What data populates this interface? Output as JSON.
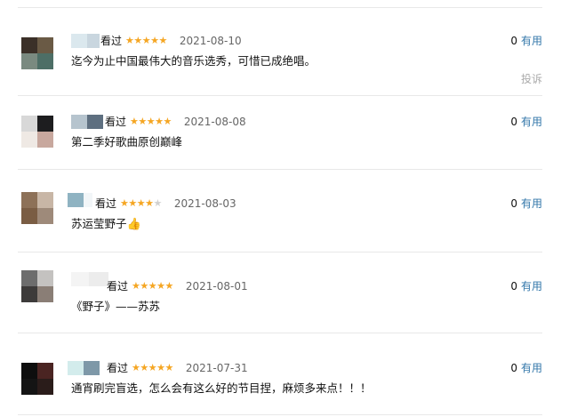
{
  "reviews": [
    {
      "seen_label": "看过",
      "rating": 5,
      "date": "2021-08-10",
      "content": "迄今为止中国最伟大的音乐选秀，可惜已成绝唱。",
      "useful_count": "0",
      "useful_label": "有用",
      "report_label": "投诉",
      "avatar_colors": [
        "#3b3028",
        "#6a5a45",
        "#7a8a80",
        "#4d6e66"
      ],
      "name_colors": [
        "#dbe8ee",
        "#c9d6df"
      ]
    },
    {
      "seen_label": "看过",
      "rating": 5,
      "date": "2021-08-08",
      "content": "第二季好歌曲原创巅峰",
      "useful_count": "0",
      "useful_label": "有用",
      "avatar_colors": [
        "#d8d8d8",
        "#1d1d1f",
        "#efe9e4",
        "#c8a89e"
      ],
      "name_colors": [
        "#b6c4ce",
        "#5e6f80"
      ]
    },
    {
      "seen_label": "看过",
      "rating": 4,
      "date": "2021-08-03",
      "content": "苏运莹野子",
      "content_icon": "👍",
      "useful_count": "0",
      "useful_label": "有用",
      "avatar_colors": [
        "#8d7158",
        "#c8b6a6",
        "#7a5d44",
        "#9e8a7a"
      ],
      "name_colors": [
        "#8fb3c2",
        "#f2f6f8"
      ]
    },
    {
      "seen_label": "看过",
      "rating": 5,
      "date": "2021-08-01",
      "content": "《野子》——苏苏",
      "useful_count": "0",
      "useful_label": "有用",
      "avatar_colors": [
        "#6d6d6d",
        "#c4c2c0",
        "#3d3b3a",
        "#8a7e76"
      ],
      "name_colors": [
        "#f4f4f4",
        "#ececec"
      ]
    },
    {
      "seen_label": "看过",
      "rating": 5,
      "date": "2021-07-31",
      "content": "通宵刷完盲选，怎么会有这么好的节目捏，麻烦多来点！！！",
      "useful_count": "0",
      "useful_label": "有用",
      "avatar_colors": [
        "#0e0e0e",
        "#4a2422",
        "#141414",
        "#2a1c1a"
      ],
      "name_colors": [
        "#d3ecec",
        "#7e98a8"
      ]
    }
  ]
}
